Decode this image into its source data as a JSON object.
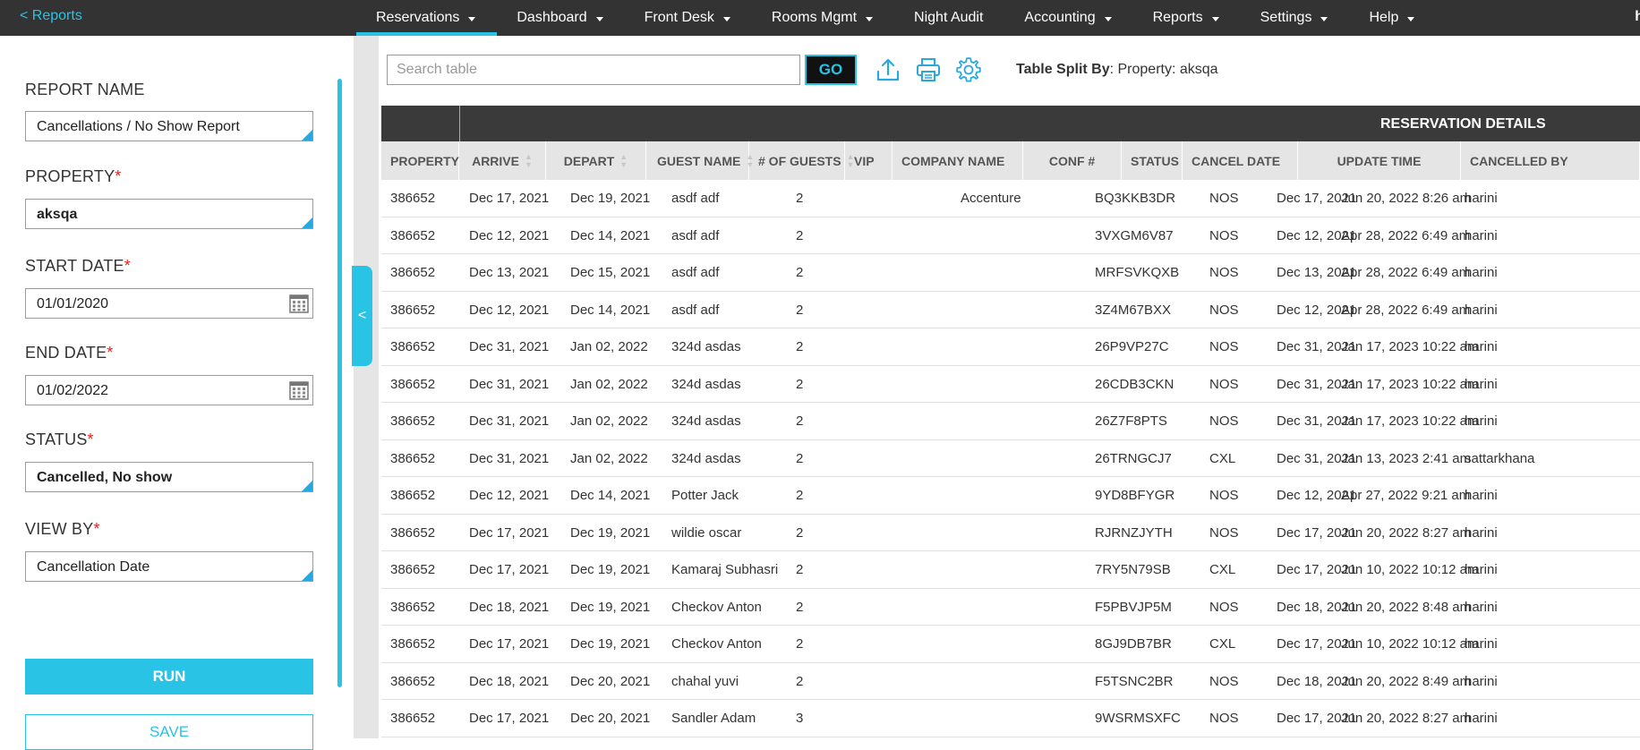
{
  "topnav": {
    "back_label": "< Reports",
    "items": [
      {
        "label": "Reservations",
        "caret": true,
        "active": true
      },
      {
        "label": "Dashboard",
        "caret": true
      },
      {
        "label": "Front Desk",
        "caret": true
      },
      {
        "label": "Rooms Mgmt",
        "caret": true
      },
      {
        "label": "Night Audit",
        "caret": false
      },
      {
        "label": "Accounting",
        "caret": true
      },
      {
        "label": "Reports",
        "caret": true
      },
      {
        "label": "Settings",
        "caret": true
      },
      {
        "label": "Help",
        "caret": true
      }
    ],
    "user_initial": "h"
  },
  "form": {
    "report_name_label": "REPORT NAME",
    "report_name_value": "Cancellations / No Show Report",
    "property_label": "PROPERTY",
    "property_value": "aksqa",
    "start_date_label": "START DATE",
    "start_date_value": "01/01/2020",
    "end_date_label": "END DATE",
    "end_date_value": "01/02/2022",
    "status_label": "STATUS",
    "status_value": "Cancelled, No show",
    "view_by_label": "VIEW BY",
    "view_by_value": "Cancellation Date",
    "required_mark": "*",
    "run_label": "RUN",
    "save_label": "SAVE",
    "collapse_glyph": "<"
  },
  "toolbar": {
    "search_placeholder": "Search table",
    "go_label": "GO",
    "split_by_label": "Table Split By",
    "split_by_value": ": Property: aksqa"
  },
  "table": {
    "group_title": "RESERVATION DETAILS",
    "columns": [
      "PROPERTY",
      "ARRIVE",
      "DEPART",
      "GUEST NAME",
      "# OF GUESTS",
      "VIP",
      "COMPANY NAME",
      "CONF #",
      "STATUS",
      "CANCEL DATE",
      "UPDATE TIME",
      "CANCELLED BY"
    ],
    "rows": [
      [
        "386652",
        "Dec 17, 2021",
        "Dec 19, 2021",
        "asdf adf",
        "2",
        "",
        "Accenture",
        "BQ3KKB3DR",
        "NOS",
        "Dec 17, 2021",
        "Jun 20, 2022 8:26 am",
        "harini"
      ],
      [
        "386652",
        "Dec 12, 2021",
        "Dec 14, 2021",
        "asdf adf",
        "2",
        "",
        "",
        "3VXGM6V87",
        "NOS",
        "Dec 12, 2021",
        "Apr 28, 2022 6:49 am",
        "harini"
      ],
      [
        "386652",
        "Dec 13, 2021",
        "Dec 15, 2021",
        "asdf adf",
        "2",
        "",
        "",
        "MRFSVKQXB",
        "NOS",
        "Dec 13, 2021",
        "Apr 28, 2022 6:49 am",
        "harini"
      ],
      [
        "386652",
        "Dec 12, 2021",
        "Dec 14, 2021",
        "asdf adf",
        "2",
        "",
        "",
        "3Z4M67BXX",
        "NOS",
        "Dec 12, 2021",
        "Apr 28, 2022 6:49 am",
        "harini"
      ],
      [
        "386652",
        "Dec 31, 2021",
        "Jan 02, 2022",
        "324d asdas",
        "2",
        "",
        "",
        "26P9VP27C",
        "NOS",
        "Dec 31, 2021",
        "Jan 17, 2023 10:22 am",
        "harini"
      ],
      [
        "386652",
        "Dec 31, 2021",
        "Jan 02, 2022",
        "324d asdas",
        "2",
        "",
        "",
        "26CDB3CKN",
        "NOS",
        "Dec 31, 2021",
        "Jan 17, 2023 10:22 am",
        "harini"
      ],
      [
        "386652",
        "Dec 31, 2021",
        "Jan 02, 2022",
        "324d asdas",
        "2",
        "",
        "",
        "26Z7F8PTS",
        "NOS",
        "Dec 31, 2021",
        "Jan 17, 2023 10:22 am",
        "harini"
      ],
      [
        "386652",
        "Dec 31, 2021",
        "Jan 02, 2022",
        "324d asdas",
        "2",
        "",
        "",
        "26TRNGCJ7",
        "CXL",
        "Dec 31, 2021",
        "Jan 13, 2023 2:41 am",
        "sattarkhana"
      ],
      [
        "386652",
        "Dec 12, 2021",
        "Dec 14, 2021",
        "Potter Jack",
        "2",
        "",
        "",
        "9YD8BFYGR",
        "NOS",
        "Dec 12, 2021",
        "Apr 27, 2022 9:21 am",
        "harini"
      ],
      [
        "386652",
        "Dec 17, 2021",
        "Dec 19, 2021",
        "wildie oscar",
        "2",
        "",
        "",
        "RJRNZJYTH",
        "NOS",
        "Dec 17, 2021",
        "Jun 20, 2022 8:27 am",
        "harini"
      ],
      [
        "386652",
        "Dec 17, 2021",
        "Dec 19, 2021",
        "Kamaraj Subhasri",
        "2",
        "",
        "",
        "7RY5N79SB",
        "CXL",
        "Dec 17, 2021",
        "Jun 10, 2022 10:12 am",
        "harini"
      ],
      [
        "386652",
        "Dec 18, 2021",
        "Dec 19, 2021",
        "Checkov Anton",
        "2",
        "",
        "",
        "F5PBVJP5M",
        "NOS",
        "Dec 18, 2021",
        "Jun 20, 2022 8:48 am",
        "harini"
      ],
      [
        "386652",
        "Dec 17, 2021",
        "Dec 19, 2021",
        "Checkov Anton",
        "2",
        "",
        "",
        "8GJ9DB7BR",
        "CXL",
        "Dec 17, 2021",
        "Jun 10, 2022 10:12 am",
        "harini"
      ],
      [
        "386652",
        "Dec 18, 2021",
        "Dec 20, 2021",
        "chahal yuvi",
        "2",
        "",
        "",
        "F5TSNC2BR",
        "NOS",
        "Dec 18, 2021",
        "Jun 20, 2022 8:49 am",
        "harini"
      ],
      [
        "386652",
        "Dec 17, 2021",
        "Dec 20, 2021",
        "Sandler Adam",
        "3",
        "",
        "",
        "9WSRMSXFC",
        "NOS",
        "Dec 17, 2021",
        "Jun 20, 2022 8:27 am",
        "harini"
      ]
    ]
  },
  "colors": {
    "accent": "#29c3e6",
    "nav_bg": "#333333",
    "required": "#e02020"
  }
}
